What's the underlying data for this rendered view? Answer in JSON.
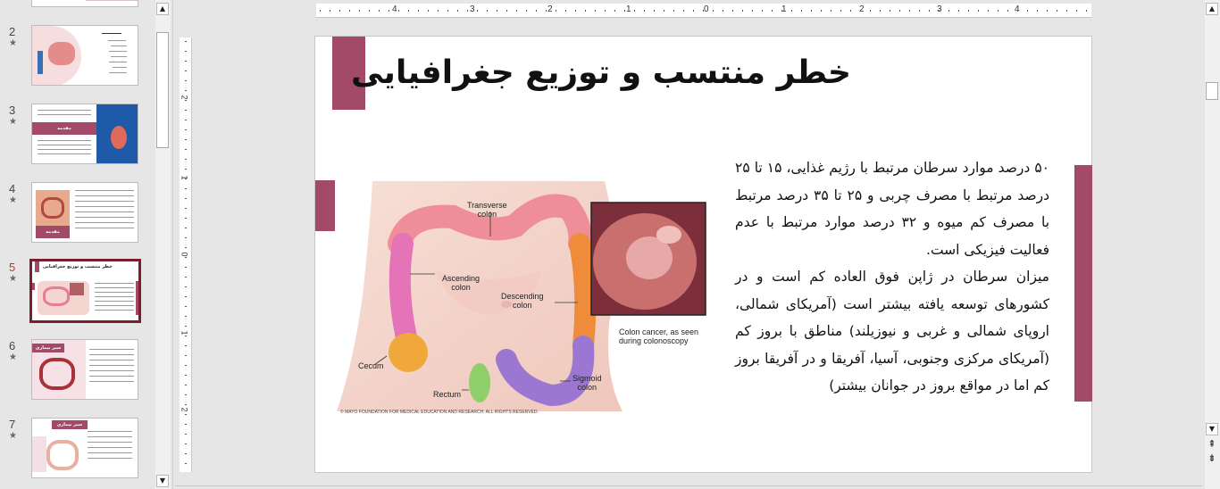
{
  "thumbnails": [
    {
      "num": "2",
      "star": "★"
    },
    {
      "num": "3",
      "star": "★",
      "chip": "مقدمه"
    },
    {
      "num": "4",
      "star": "★",
      "chip": "مقدمه"
    },
    {
      "num": "5",
      "star": "★",
      "title": "خطر منتسب و توزیع جغرافیایی",
      "active": true
    },
    {
      "num": "6",
      "star": "★",
      "chip": "سیر بیماری"
    },
    {
      "num": "7",
      "star": "★",
      "chip": "سیر بیماری"
    }
  ],
  "ruler": {
    "horizontal": [
      "4",
      "3",
      "2",
      "1",
      "0",
      "1",
      "2",
      "3",
      "4"
    ],
    "vertical": [
      "2",
      "1",
      "0",
      "1",
      "2"
    ]
  },
  "slide": {
    "title": "خطر منتسب و توزیع جغرافیایی",
    "paragraphs": [
      "۵۰ درصد موارد سرطان مرتبط با رژیم غذایی، ۱۵ تا ۲۵ درصد مرتبط با مصرف چربی و ۲۵ تا ۳۵ درصد مرتبط با مصرف کم میوه و ۳۲ درصد موارد مرتبط با عدم فعالیت فیزیکی است.",
      "میزان سرطان در ژاپن فوق العاده کم است و در کشورهای توسعه یافته بیشتر است (آمریکای شمالی، اروپای شمالی و غربی و نیوزیلند) مناطق با بروز کم (آمریکای مرکزی وجنوبی، آسیا، آفریقا و در آفریقا بروز کم اما در مواقع بروز در جوانان بیشتر)"
    ],
    "illustration": {
      "labels": {
        "transverse": "Transverse\ncolon",
        "ascending": "Ascending\ncolon",
        "descending": "Descending\ncolon",
        "cecum": "Cecum",
        "rectum": "Rectum",
        "sigmoid": "Sigmoid\ncolon",
        "inset": "Colon cancer, as seen\nduring colonoscopy"
      },
      "copyright": "© MAYO FOUNDATION FOR MEDICAL EDUCATION AND RESEARCH. ALL RIGHTS RESERVED."
    }
  },
  "colors": {
    "accent": "#a24a68",
    "active_border": "#7b1f2e"
  },
  "icons": {
    "scroll_up": "▲",
    "scroll_down": "▼",
    "prev_slide": "⇞",
    "next_slide": "⇟"
  }
}
